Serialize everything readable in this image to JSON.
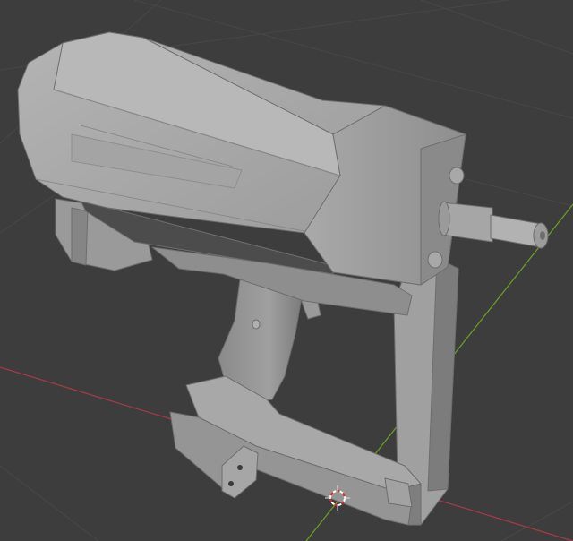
{
  "viewport": {
    "background": "#3d3d3d",
    "grid_color": "#474747",
    "x_axis_color": "#a33a48",
    "y_axis_color": "#6b9a23"
  },
  "model": {
    "object": "nail-gun-mesh",
    "shading": "solid",
    "base_color": "#9c9c9c"
  },
  "cursor_3d": {
    "colors": [
      "#ffffff",
      "#d23030"
    ]
  }
}
